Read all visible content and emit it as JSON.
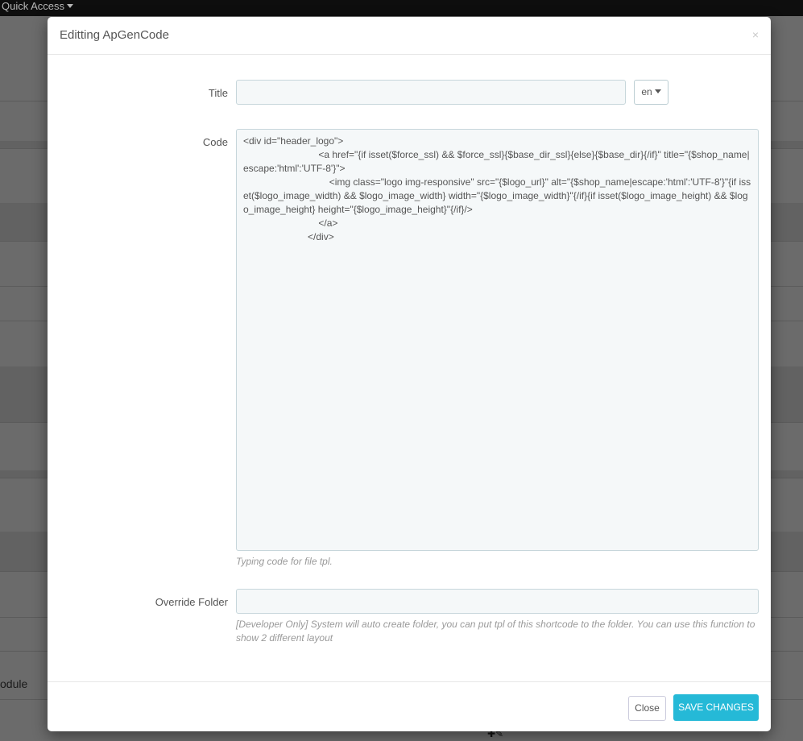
{
  "background": {
    "quick_access": "Quick Access",
    "module_text": "odule",
    "icons": "✚✎"
  },
  "modal": {
    "title": "Editting ApGenCode",
    "close_glyph": "×",
    "fields": {
      "title_label": "Title",
      "title_value": "",
      "lang": "en",
      "code_label": "Code",
      "code_value": "<div id=\"header_logo\">\n\t\t\t\t\t\t\t<a href=\"{if isset($force_ssl) && $force_ssl}{$base_dir_ssl}{else}{$base_dir}{/if}\" title=\"{$shop_name|escape:'html':'UTF-8'}\">\n\t\t\t\t\t\t\t\t<img class=\"logo img-responsive\" src=\"{$logo_url}\" alt=\"{$shop_name|escape:'html':'UTF-8'}\"{if isset($logo_image_width) && $logo_image_width} width=\"{$logo_image_width}\"{/if}{if isset($logo_image_height) && $logo_image_height} height=\"{$logo_image_height}\"{/if}/>\n\t\t\t\t\t\t\t</a>\n\t\t\t\t\t\t</div>",
      "code_help": "Typing code for file tpl.",
      "override_label": "Override Folder",
      "override_value": "",
      "override_help": "[Developer Only] System will auto create folder, you can put tpl of this shortcode to the folder. You can use this function to show 2 different layout"
    },
    "footer": {
      "close_label": "Close",
      "save_label": "Save changes"
    }
  }
}
